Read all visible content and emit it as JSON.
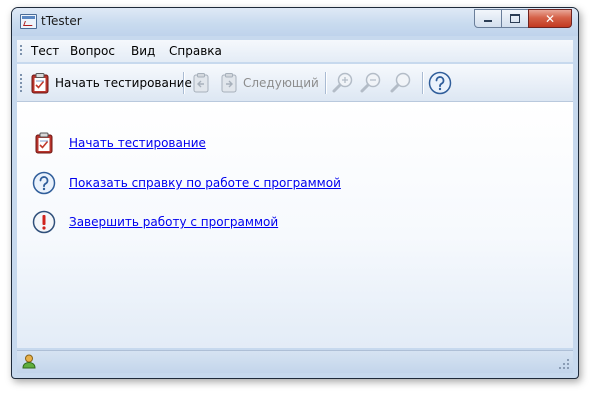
{
  "window": {
    "title": "tTester",
    "icon": "app-icon",
    "controls": {
      "minimize": "minimize-icon",
      "maximize": "maximize-icon",
      "close": "close-icon"
    }
  },
  "menu": {
    "items": [
      {
        "label": "Тест"
      },
      {
        "label": "Вопрос"
      },
      {
        "label": "Вид"
      },
      {
        "label": "Справка"
      }
    ]
  },
  "toolbar": {
    "start_test": {
      "label": "Начать тестирование",
      "icon": "clipboard-test-icon",
      "enabled": true
    },
    "prev": {
      "icon": "prev-page-icon",
      "enabled": false
    },
    "next": {
      "label": "Следующий",
      "icon": "next-page-icon",
      "enabled": false
    },
    "zoom_in": {
      "icon": "zoom-in-icon",
      "enabled": false
    },
    "zoom_out": {
      "icon": "zoom-out-icon",
      "enabled": false
    },
    "zoom": {
      "icon": "zoom-icon",
      "enabled": false
    },
    "help": {
      "icon": "help-icon",
      "enabled": true
    }
  },
  "content": {
    "links": [
      {
        "label": "Начать тестирование",
        "icon": "clipboard-test-icon"
      },
      {
        "label": "Показать справку по работе с программой",
        "icon": "help-icon"
      },
      {
        "label": "Завершить работу с программой",
        "icon": "exit-icon"
      }
    ]
  },
  "statusbar": {
    "icon": "user-icon"
  },
  "colors": {
    "link": "#0000ee",
    "window_frame": "#c7d9ee",
    "close_button": "#c23a22",
    "disabled_text": "#8c8c8c"
  }
}
